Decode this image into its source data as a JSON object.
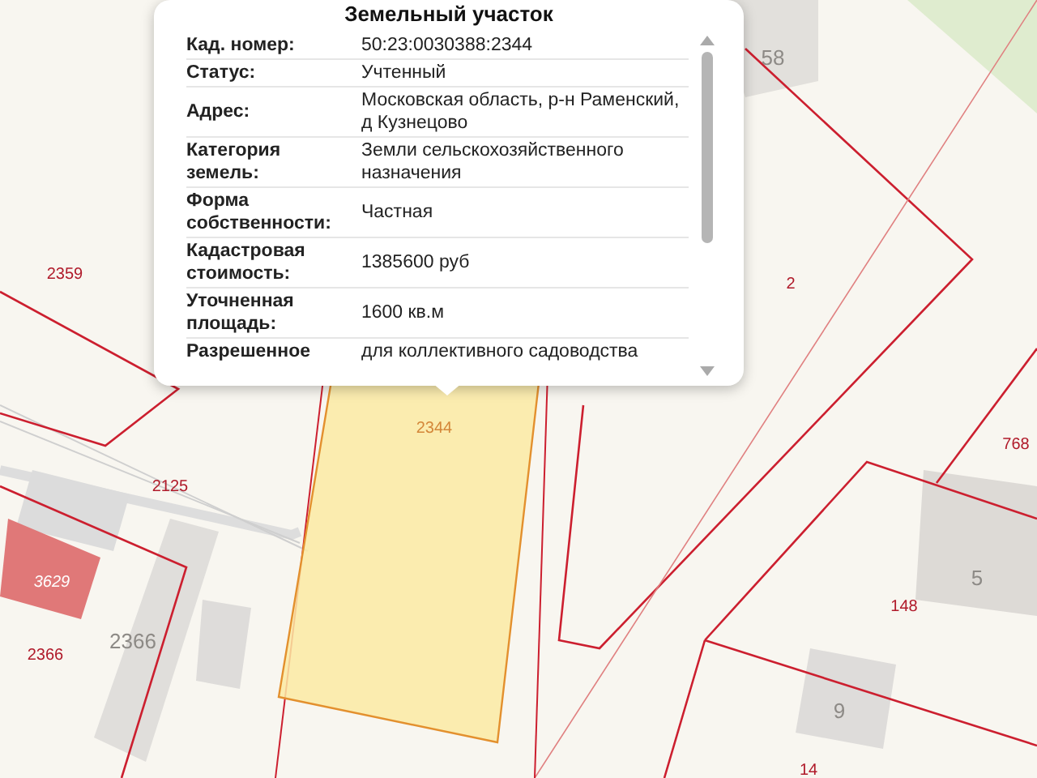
{
  "popup": {
    "title": "Земельный участок",
    "rows": [
      {
        "label": "Кад. номер:",
        "value": "50:23:0030388:2344"
      },
      {
        "label": "Статус:",
        "value": "Учтенный"
      },
      {
        "label": "Адрес:",
        "value": "Московская область, р-н Раменский, д Кузнецово"
      },
      {
        "label": "Категория земель:",
        "value": "Земли сельскохозяйственного назначения"
      },
      {
        "label": "Форма собственности:",
        "value": "Частная"
      },
      {
        "label": "Кадастровая стоимость:",
        "value": "1385600 руб"
      },
      {
        "label": "Уточненная площадь:",
        "value": "1600 кв.м"
      },
      {
        "label": "Разрешенное",
        "value": "для коллективного садоводства"
      }
    ]
  },
  "map_labels": [
    {
      "text": "2359",
      "kind": "parcel"
    },
    {
      "text": "2125",
      "kind": "parcel"
    },
    {
      "text": "3629",
      "kind": "highlighted"
    },
    {
      "text": "2366",
      "kind": "parcel"
    },
    {
      "text": "2366",
      "kind": "building"
    },
    {
      "text": "2344",
      "kind": "selected"
    },
    {
      "text": "58",
      "kind": "building"
    },
    {
      "text": "2",
      "kind": "parcel"
    },
    {
      "text": "768",
      "kind": "parcel"
    },
    {
      "text": "5",
      "kind": "building"
    },
    {
      "text": "148",
      "kind": "parcel"
    },
    {
      "text": "9",
      "kind": "building"
    },
    {
      "text": "14",
      "kind": "parcel"
    }
  ]
}
